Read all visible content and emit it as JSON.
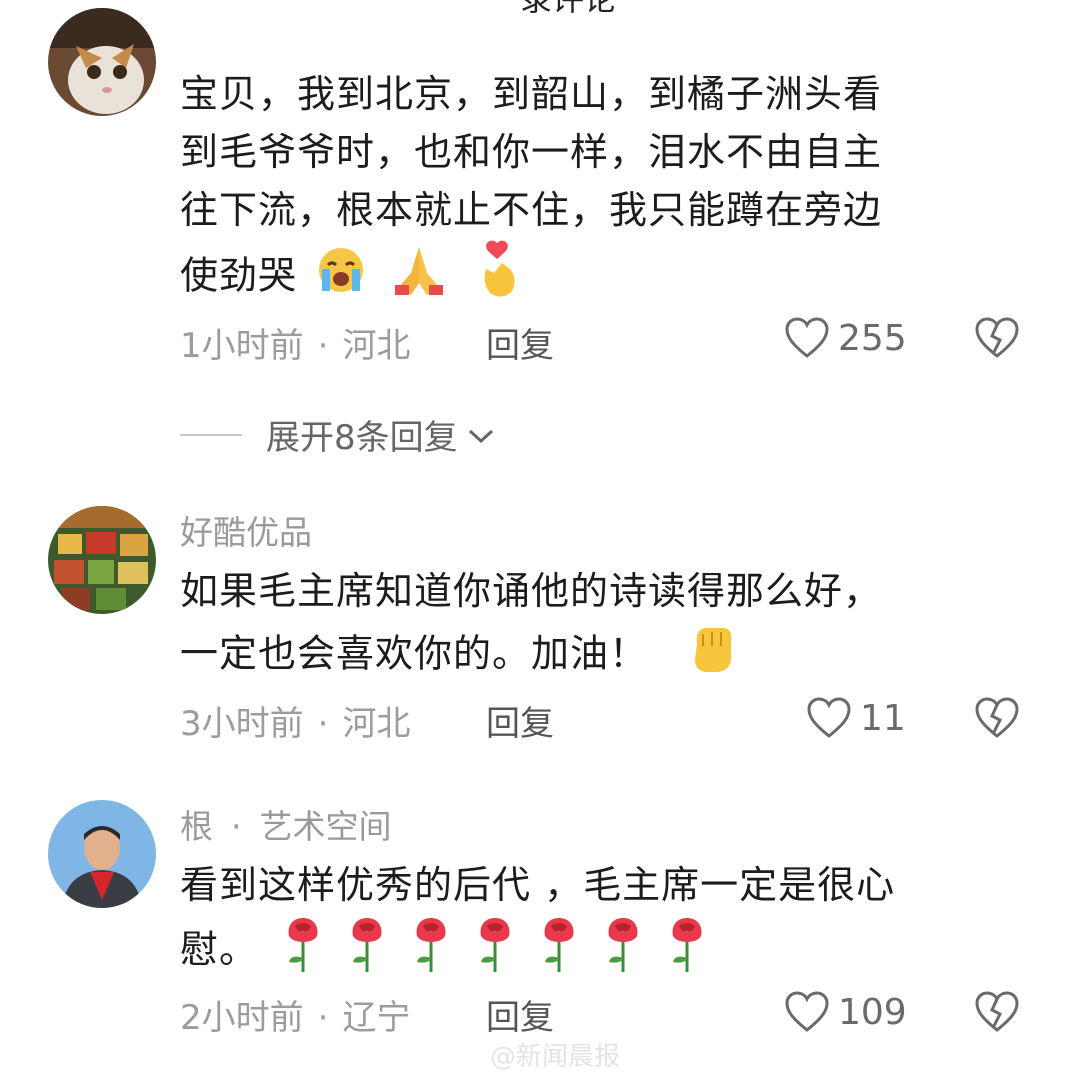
{
  "top_partial_text": "录评论",
  "comments": [
    {
      "text_line1": "宝贝，我到北京，到韶山，到橘子洲头看",
      "text_line2": "到毛爷爷时，也和你一样，泪水不由自主",
      "text_line3": "往下流，根本就止不住，我只能蹲在旁边",
      "text_line4": "使劲哭",
      "time": "1小时前",
      "location": "河北",
      "reply_label": "回复",
      "likes": "255",
      "emojis": [
        "crying-face-emoji",
        "folded-hands-emoji",
        "finger-heart-emoji"
      ]
    },
    {
      "username": "好酷优品",
      "text_line1": "如果毛主席知道你诵他的诗读得那么好，",
      "text_line2": "一定也会喜欢你的。加油！",
      "time": "3小时前",
      "location": "河北",
      "reply_label": "回复",
      "likes": "11",
      "emojis": [
        "raised-fist-emoji"
      ]
    },
    {
      "username": "根",
      "username_tag": "艺术空间",
      "text_line1": "看到这样优秀的后代 ，毛主席一定是很心",
      "text_line2": "慰。",
      "time": "2小时前",
      "location": "辽宁",
      "reply_label": "回复",
      "likes": "109",
      "emojis": [
        "rose-emoji",
        "rose-emoji",
        "rose-emoji",
        "rose-emoji",
        "rose-emoji",
        "rose-emoji",
        "rose-emoji"
      ]
    }
  ],
  "expand_replies": "展开8条回复",
  "separator": "·",
  "watermark": "@新闻晨报"
}
